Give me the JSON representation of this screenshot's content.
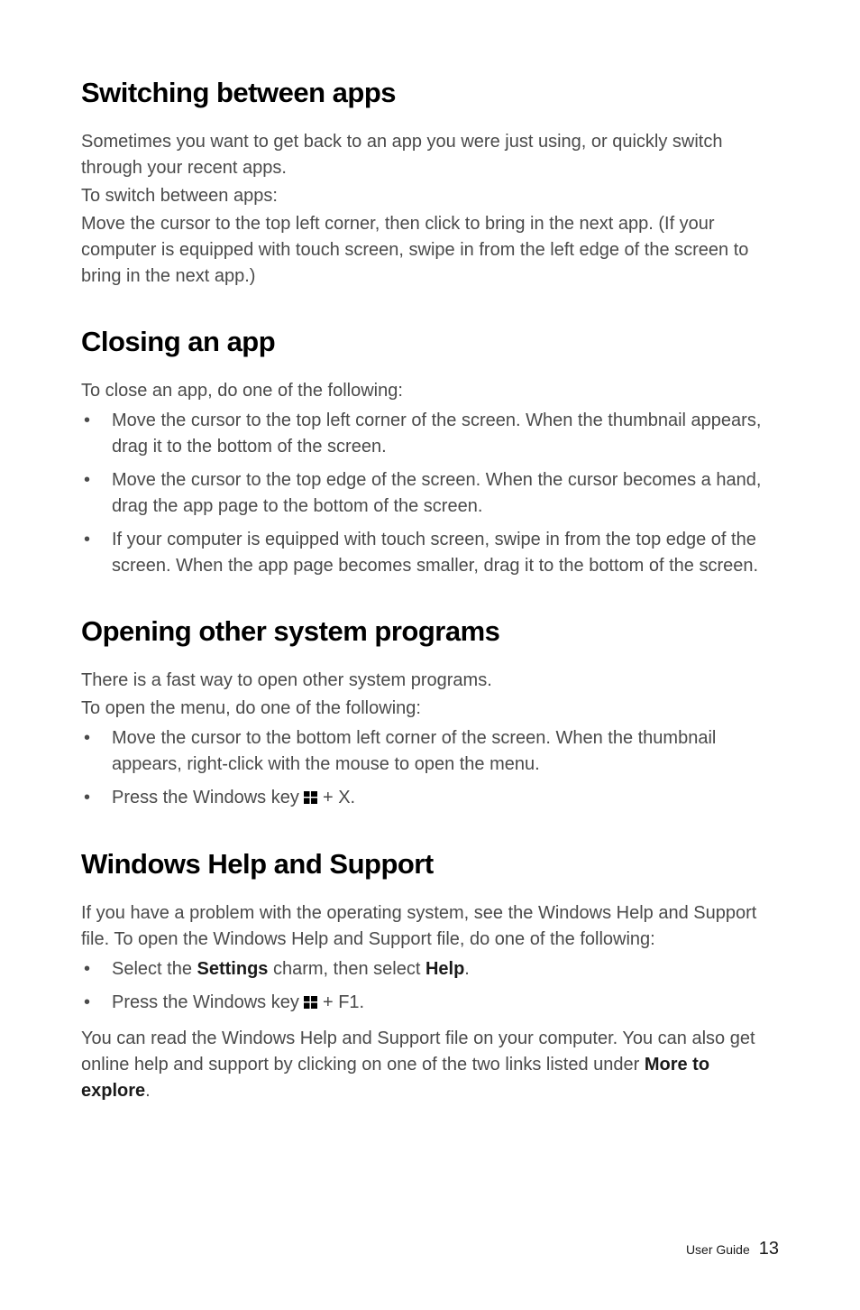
{
  "sections": {
    "switching": {
      "heading": "Switching between apps",
      "p1": "Sometimes you want to get back to an app you were just using, or quickly switch through your recent apps.",
      "p2": "To switch between apps:",
      "p3": "Move the cursor to the top left corner, then click to bring in the next app. (If your computer is equipped with touch screen, swipe in from the left edge of the screen to bring in the next app.)"
    },
    "closing": {
      "heading": "Closing an app",
      "intro": "To close an app, do one of the following:",
      "items": [
        "Move the cursor to the top left corner of the screen. When the thumbnail appears, drag it to the bottom of the screen.",
        "Move the cursor to the top edge of the screen. When the cursor becomes a hand, drag the app page to the bottom of the screen.",
        "If your computer is equipped with touch screen, swipe in from the top edge of the screen. When the app page becomes smaller, drag it to the bottom of the screen."
      ]
    },
    "opening": {
      "heading": "Opening other system programs",
      "p1": "There is a fast way to open other system programs.",
      "p2": "To open the menu, do one of the following:",
      "items": {
        "i0": "Move the cursor to the bottom left corner of the screen. When the thumbnail appears, right-click with the mouse to open the menu.",
        "i1_prefix": "Press the Windows key ",
        "i1_suffix": " + X."
      }
    },
    "help": {
      "heading": "Windows Help and Support",
      "p1": "If you have a problem with the operating system, see the Windows Help and Support file. To open the Windows Help and Support file, do one of the following:",
      "items": {
        "i0_a": "Select the ",
        "i0_b": "Settings",
        "i0_c": " charm, then select ",
        "i0_d": "Help",
        "i0_e": ".",
        "i1_prefix": "Press the Windows key ",
        "i1_suffix": " + F1."
      },
      "p2_a": "You can read the Windows Help and Support file on your computer. You can also get online help and support by clicking on one of the two links listed under ",
      "p2_b": "More to explore",
      "p2_c": "."
    }
  },
  "footer": {
    "label": "User Guide",
    "page": "13"
  }
}
